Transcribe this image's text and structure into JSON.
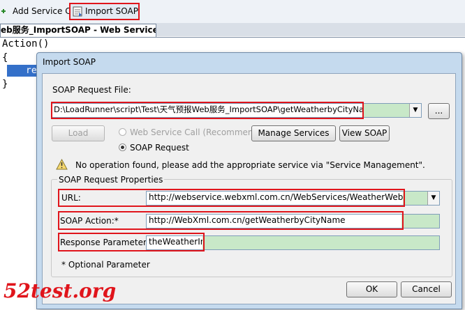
{
  "toolbar": {
    "add_service_call": "Add Service Call",
    "import_soap": "Import SOAP"
  },
  "document_tab": {
    "title": "eb服务_ImportSOAP - Web Services"
  },
  "editor": {
    "lines": [
      "Action()",
      "{",
      "}"
    ],
    "highlight": "re"
  },
  "dialog": {
    "title": "Import SOAP",
    "soap_request_file_label": "SOAP Request File:",
    "soap_request_file_value": "D:\\LoadRunner\\script\\Test\\天气预报Web服务_ImportSOAP\\getWeatherbyCityName.xml",
    "browse_label": "...",
    "load_label": "Load",
    "radio_web_service_call": "Web Service Call (Recommended)",
    "radio_soap_request": "SOAP Request",
    "manage_services_label": "Manage Services",
    "view_soap_label": "View SOAP",
    "warning_text": "No operation found, please add the appropriate service via \"Service Management\".",
    "properties_group_label": "SOAP Request Properties",
    "url_label": "URL:",
    "url_value": "http://webservice.webxml.com.cn/WebServices/WeatherWebService.asmx",
    "soap_action_label": "SOAP Action:*",
    "soap_action_value": "http://WebXml.com.cn/getWeatherbyCityName",
    "response_parameter_label": "Response Parameter:*",
    "response_parameter_value": "theWeatherInfo",
    "optional_note": "* Optional Parameter",
    "ok_label": "OK",
    "cancel_label": "Cancel"
  },
  "watermark": "52test.org",
  "colors": {
    "highlight_red": "#e0141b",
    "field_green": "#c8e8c8",
    "selection_blue": "#3470c9"
  }
}
